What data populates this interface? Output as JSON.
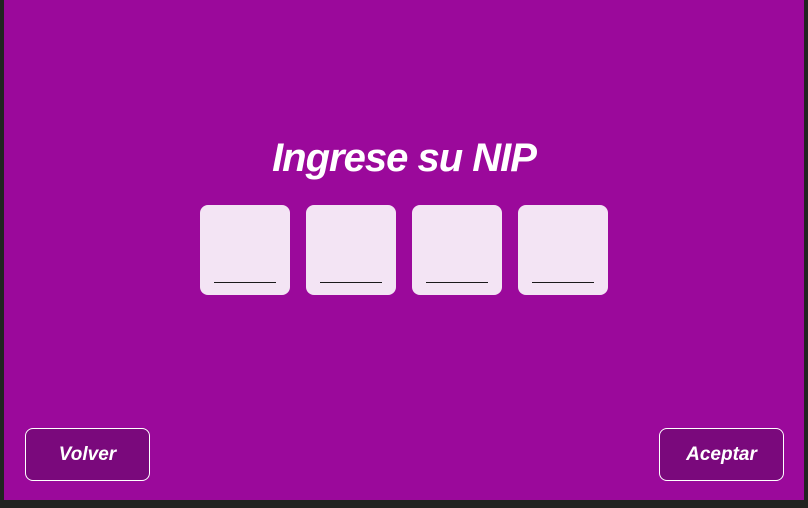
{
  "screen": {
    "title": "Ingrese su NIP",
    "background_color": "#9b099b",
    "pin_box_color": "#f3e4f4",
    "button_color": "#7a097c"
  },
  "pin": {
    "digits": [
      "",
      "",
      "",
      ""
    ]
  },
  "actions": {
    "back_label": "Volver",
    "accept_label": "Aceptar"
  }
}
